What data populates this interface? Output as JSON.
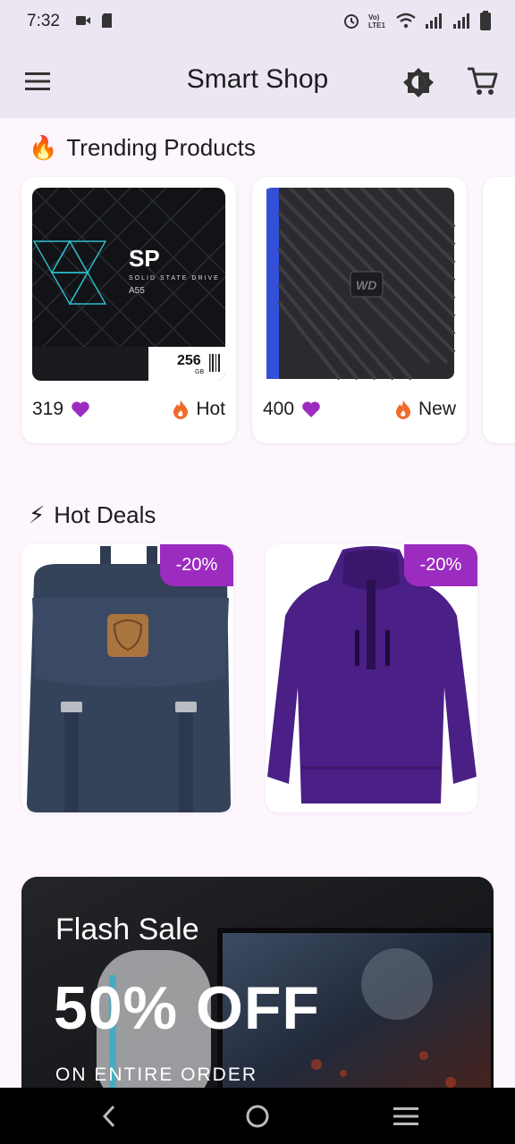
{
  "status": {
    "time": "7:32",
    "icons": [
      "video-icon",
      "sim-card-icon",
      "alarm-icon",
      "volte-icon",
      "wifi-icon",
      "signal-icon",
      "signal-icon",
      "battery-icon"
    ]
  },
  "appbar": {
    "title": "Smart Shop",
    "icons": [
      "menu-icon",
      "brightness-icon",
      "cart-icon"
    ]
  },
  "trending": {
    "title": "Trending Products",
    "emoji": "🔥",
    "items": [
      {
        "likes": "319",
        "tag": "Hot",
        "image": "ssd-product-image"
      },
      {
        "likes": "400",
        "tag": "New",
        "image": "hdd-product-image"
      }
    ]
  },
  "deals": {
    "title": "Hot Deals",
    "emoji": "⚡",
    "items": [
      {
        "badge": "-20%",
        "image": "backpack-image"
      },
      {
        "badge": "-20%",
        "image": "jacket-image"
      }
    ]
  },
  "flash": {
    "title": "Flash Sale",
    "headline": "50% OFF",
    "subtitle": "ON ENTIRE ORDER"
  },
  "colors": {
    "accent": "#9c2cc0",
    "appbar": "#ebe6f1",
    "background": "#fdf6fd"
  }
}
